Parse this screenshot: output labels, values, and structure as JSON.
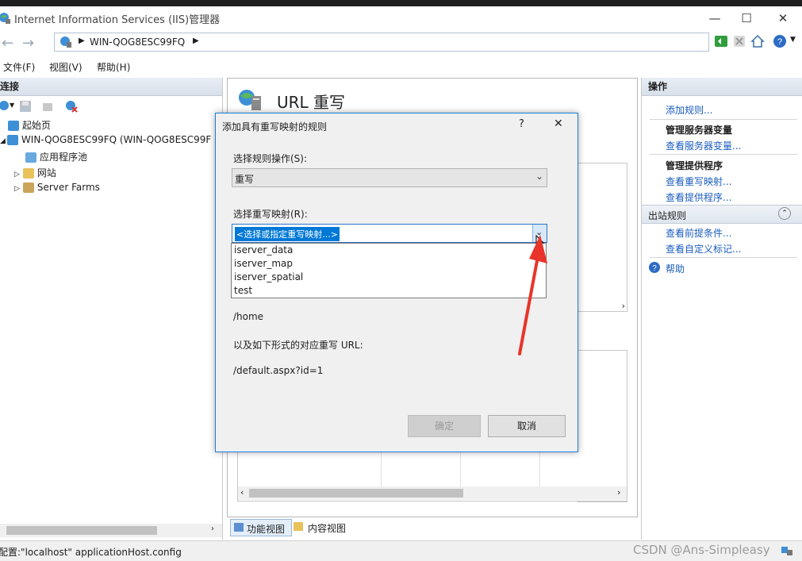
{
  "window": {
    "title": "Internet Information Services (IIS)管理器",
    "controls": {
      "minimize": "—",
      "maximize": "☐",
      "close": "✕"
    }
  },
  "address": {
    "path": "WIN-QOG8ESC99FQ"
  },
  "menu": {
    "file": "文件(F)",
    "view": "视图(V)",
    "help": "帮助(H)"
  },
  "left_pane": {
    "header": "连接",
    "tree": [
      {
        "label": "起始页"
      },
      {
        "label": "WIN-QOG8ESC99FQ (WIN-QOG8ESC99F"
      },
      {
        "label": "应用程序池"
      },
      {
        "label": "网站"
      },
      {
        "label": "Server Farms"
      }
    ]
  },
  "center": {
    "heading": "URL 重写"
  },
  "view_tabs": {
    "feature": "功能视图",
    "content": "内容视图"
  },
  "status": {
    "text": "配置:\"localhost\" applicationHost.config"
  },
  "right_pane": {
    "header": "操作",
    "add_rule": "添加规则...",
    "server_vars_head": "管理服务器变量",
    "view_server_vars": "查看服务器变量...",
    "providers_head": "管理提供程序",
    "view_rewrite_maps": "查看重写映射...",
    "view_providers": "查看提供程序...",
    "outbound_head": "出站规则",
    "view_preconditions": "查看前提条件...",
    "view_custom_tags": "查看自定义标记...",
    "help": "帮助"
  },
  "dialog": {
    "title": "添加具有重写映射的规则",
    "help": "?",
    "close": "✕",
    "action_label": "选择规则操作(S):",
    "action_value": "重写",
    "map_label": "选择重写映射(R):",
    "map_value": "<选择或指定重写映射...>",
    "map_options": [
      "iserver_data",
      "iserver_map",
      "iserver_spatial",
      "test"
    ],
    "example_path": "/home",
    "example_label": "以及如下形式的对应重写 URL:",
    "example_url": "/default.aspx?id=1",
    "ok": "确定",
    "cancel": "取消"
  },
  "watermark": "CSDN @Ans-Simpleasy",
  "colors": {
    "link": "#1a5cbf",
    "selection": "#0078d7",
    "dialog_border": "#1a7fd4",
    "annotation_arrow": "#e8342a"
  }
}
